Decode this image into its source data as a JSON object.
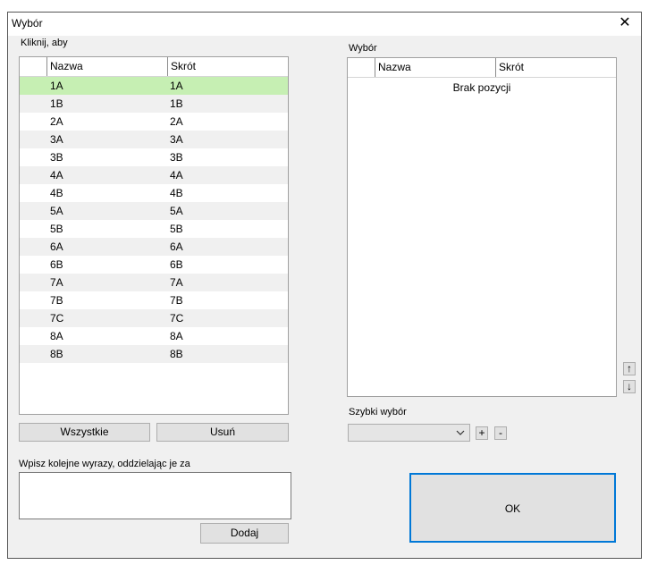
{
  "window": {
    "title": "Wybór",
    "close_glyph": "✕"
  },
  "left": {
    "label": "Kliknij, aby",
    "columns": [
      "Nazwa",
      "Skrót"
    ],
    "rows": [
      [
        "1A",
        "1A"
      ],
      [
        "1B",
        "1B"
      ],
      [
        "2A",
        "2A"
      ],
      [
        "3A",
        "3A"
      ],
      [
        "3B",
        "3B"
      ],
      [
        "4A",
        "4A"
      ],
      [
        "4B",
        "4B"
      ],
      [
        "5A",
        "5A"
      ],
      [
        "5B",
        "5B"
      ],
      [
        "6A",
        "6A"
      ],
      [
        "6B",
        "6B"
      ],
      [
        "7A",
        "7A"
      ],
      [
        "7B",
        "7B"
      ],
      [
        "7C",
        "7C"
      ],
      [
        "8A",
        "8A"
      ],
      [
        "8B",
        "8B"
      ]
    ],
    "selected_index": 0,
    "buttons": {
      "all": "Wszystkie",
      "remove": "Usuń"
    }
  },
  "right": {
    "label": "Wybór",
    "columns": [
      "Nazwa",
      "Skrót"
    ],
    "empty_text": "Brak pozycji",
    "quick_label": "Szybki wybór",
    "quick_value": "",
    "plus": "+",
    "minus": "-"
  },
  "entry": {
    "label": "Wpisz kolejne wyrazy, oddzielając je za",
    "value": "",
    "add_button": "Dodaj"
  },
  "ok_button": "OK",
  "colors": {
    "selected_row": "#c6efb3",
    "ok_border": "#0078d7"
  }
}
